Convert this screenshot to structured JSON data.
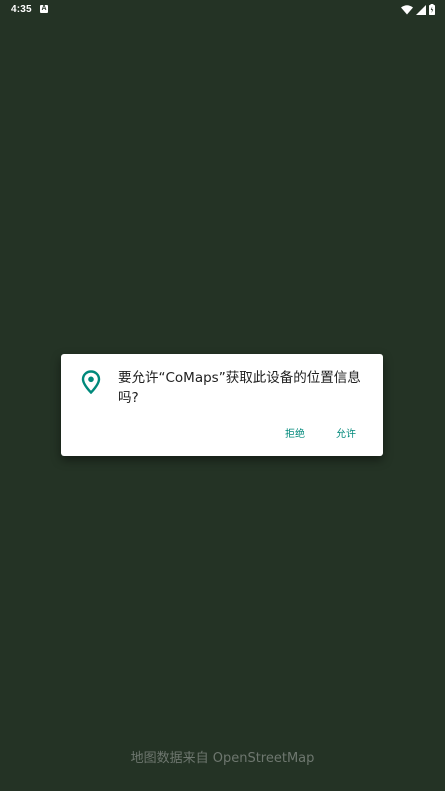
{
  "status_bar": {
    "time": "4:35",
    "app_icon_letter": "A",
    "icons": [
      "wifi-icon",
      "cell-signal-icon",
      "battery-icon"
    ]
  },
  "dialog": {
    "icon": "location-pin-icon",
    "accent_color": "#00897b",
    "message": "要允许“CoMaps”获取此设备的位置信息吗?",
    "deny_label": "拒绝",
    "allow_label": "允许"
  },
  "map": {
    "background_color": "#243325",
    "attribution": "地图数据来自 OpenStreetMap"
  }
}
